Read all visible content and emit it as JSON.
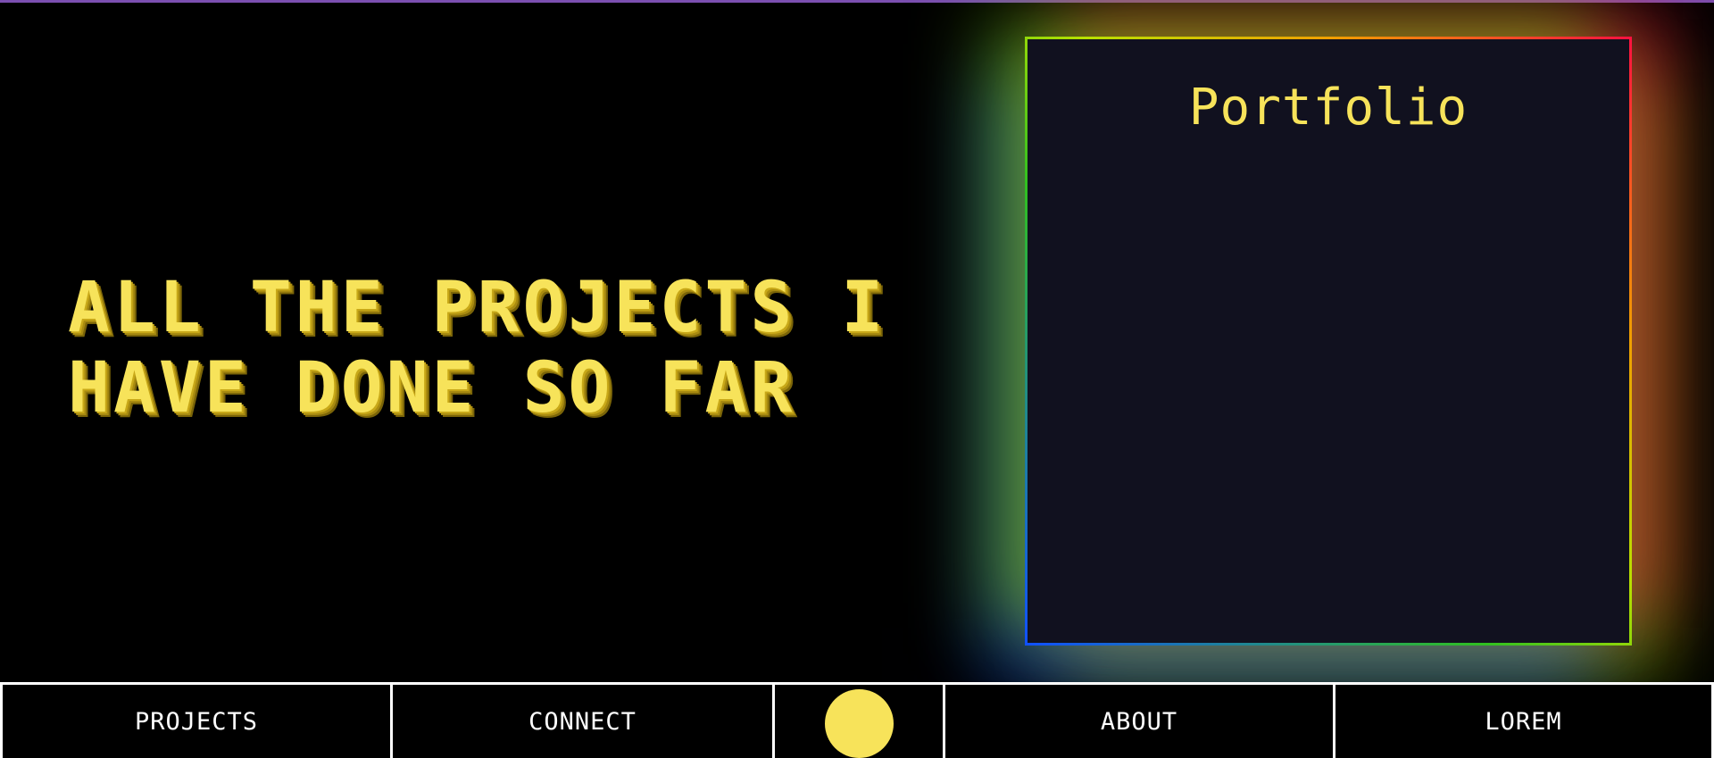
{
  "hero": {
    "line1": "ALL THE PROJECTS I",
    "line2": "HAVE DONE SO FAR"
  },
  "card": {
    "title": "Portfolio"
  },
  "nav": {
    "items": [
      {
        "label": "PROJECTS"
      },
      {
        "label": "CONNECT"
      },
      {
        "label": "ABOUT"
      },
      {
        "label": "LOREM"
      }
    ],
    "logo_icon": "circle-logo-icon"
  },
  "colors": {
    "accent_yellow": "#f7e35a",
    "card_background": "#11111f",
    "page_background": "#000000",
    "nav_border": "#ffffff",
    "top_line": "#7b4fb0"
  }
}
